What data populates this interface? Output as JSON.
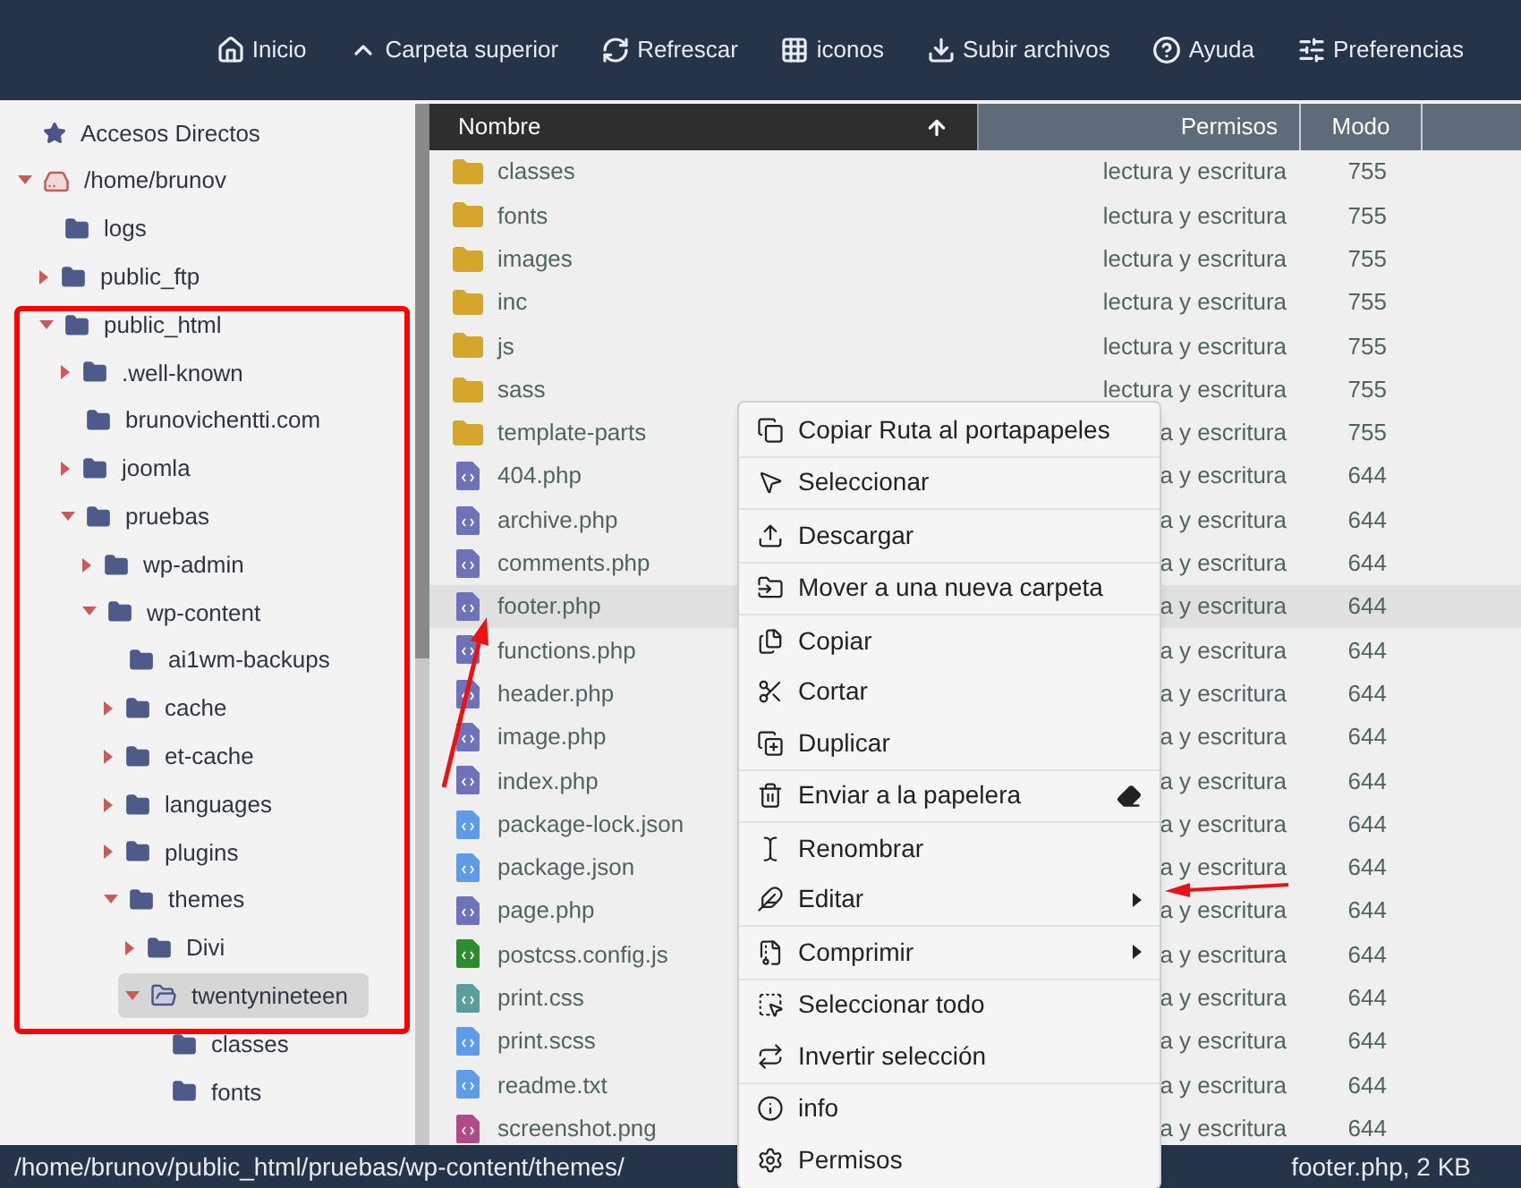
{
  "toolbar": [
    {
      "label": "Inicio"
    },
    {
      "label": "Carpeta superior"
    },
    {
      "label": "Refrescar"
    },
    {
      "label": "iconos"
    },
    {
      "label": "Subir archivos"
    },
    {
      "label": "Ayuda"
    },
    {
      "label": "Preferencias"
    }
  ],
  "tree": [
    {
      "label": "Accesos Directos",
      "kind": "shortcut",
      "selected": false
    },
    {
      "label": "/home/brunov",
      "kind": "drive",
      "expanded": true,
      "selected": false,
      "children": [
        {
          "label": "logs",
          "kind": "folder",
          "selected": false
        },
        {
          "label": "public_ftp",
          "kind": "folder",
          "expanded": false,
          "selected": false
        },
        {
          "label": "public_html",
          "kind": "folder",
          "expanded": true,
          "selected": false,
          "children": [
            {
              "label": ".well-known",
              "kind": "folder",
              "expanded": false,
              "selected": false
            },
            {
              "label": "brunovichentti.com",
              "kind": "folder",
              "selected": false
            },
            {
              "label": "joomla",
              "kind": "folder",
              "expanded": false,
              "selected": false
            },
            {
              "label": "pruebas",
              "kind": "folder",
              "expanded": true,
              "selected": false,
              "children": [
                {
                  "label": "wp-admin",
                  "kind": "folder",
                  "expanded": false,
                  "selected": false
                },
                {
                  "label": "wp-content",
                  "kind": "folder",
                  "expanded": true,
                  "selected": false,
                  "children": [
                    {
                      "label": "ai1wm-backups",
                      "kind": "folder",
                      "selected": false
                    },
                    {
                      "label": "cache",
                      "kind": "folder",
                      "expanded": false,
                      "selected": false
                    },
                    {
                      "label": "et-cache",
                      "kind": "folder",
                      "expanded": false,
                      "selected": false
                    },
                    {
                      "label": "languages",
                      "kind": "folder",
                      "expanded": false,
                      "selected": false
                    },
                    {
                      "label": "plugins",
                      "kind": "folder",
                      "expanded": false,
                      "selected": false
                    },
                    {
                      "label": "themes",
                      "kind": "folder",
                      "expanded": true,
                      "selected": false,
                      "children": [
                        {
                          "label": "Divi",
                          "kind": "folder",
                          "expanded": false,
                          "selected": false
                        },
                        {
                          "label": "twentynineteen",
                          "kind": "open-folder",
                          "expanded": true,
                          "selected": true,
                          "children": [
                            {
                              "label": "classes",
                              "kind": "folder",
                              "selected": false
                            },
                            {
                              "label": "fonts",
                              "kind": "folder",
                              "selected": false
                            }
                          ]
                        }
                      ]
                    }
                  ]
                }
              ]
            }
          ]
        }
      ]
    }
  ],
  "table": {
    "columns": [
      "Nombre",
      "Permisos",
      "Modo"
    ],
    "rows": [
      {
        "name": "classes",
        "kind": "folder",
        "permissions": "lectura y escritura",
        "mode": "755",
        "selected": false
      },
      {
        "name": "fonts",
        "kind": "folder",
        "permissions": "lectura y escritura",
        "mode": "755",
        "selected": false
      },
      {
        "name": "images",
        "kind": "folder",
        "permissions": "lectura y escritura",
        "mode": "755",
        "selected": false
      },
      {
        "name": "inc",
        "kind": "folder",
        "permissions": "lectura y escritura",
        "mode": "755",
        "selected": false
      },
      {
        "name": "js",
        "kind": "folder",
        "permissions": "lectura y escritura",
        "mode": "755",
        "selected": false
      },
      {
        "name": "sass",
        "kind": "folder",
        "permissions": "lectura y escritura",
        "mode": "755",
        "selected": false
      },
      {
        "name": "template-parts",
        "kind": "folder",
        "permissions": "a y escritura",
        "mode": "755",
        "selected": false
      },
      {
        "name": "404.php",
        "kind": "php",
        "permissions": "a y escritura",
        "mode": "644",
        "selected": false
      },
      {
        "name": "archive.php",
        "kind": "php",
        "permissions": "a y escritura",
        "mode": "644",
        "selected": false
      },
      {
        "name": "comments.php",
        "kind": "php",
        "permissions": "a y escritura",
        "mode": "644",
        "selected": false
      },
      {
        "name": "footer.php",
        "kind": "php",
        "permissions": "a y escritura",
        "mode": "644",
        "selected": true
      },
      {
        "name": "functions.php",
        "kind": "php",
        "permissions": "a y escritura",
        "mode": "644",
        "selected": false
      },
      {
        "name": "header.php",
        "kind": "php",
        "permissions": "a y escritura",
        "mode": "644",
        "selected": false
      },
      {
        "name": "image.php",
        "kind": "php",
        "permissions": "a y escritura",
        "mode": "644",
        "selected": false
      },
      {
        "name": "index.php",
        "kind": "php",
        "permissions": "a y escritura",
        "mode": "644",
        "selected": false
      },
      {
        "name": "package-lock.json",
        "kind": "text",
        "permissions": "a y escritura",
        "mode": "644",
        "selected": false
      },
      {
        "name": "package.json",
        "kind": "text",
        "permissions": "a y escritura",
        "mode": "644",
        "selected": false
      },
      {
        "name": "page.php",
        "kind": "php",
        "permissions": "a y escritura",
        "mode": "644",
        "selected": false
      },
      {
        "name": "postcss.config.js",
        "kind": "js",
        "permissions": "a y escritura",
        "mode": "644",
        "selected": false
      },
      {
        "name": "print.css",
        "kind": "css",
        "permissions": "a y escritura",
        "mode": "644",
        "selected": false
      },
      {
        "name": "print.scss",
        "kind": "text",
        "permissions": "a y escritura",
        "mode": "644",
        "selected": false
      },
      {
        "name": "readme.txt",
        "kind": "text",
        "permissions": "a y escritura",
        "mode": "644",
        "selected": false
      },
      {
        "name": "screenshot.png",
        "kind": "image",
        "permissions": "a y escritura",
        "mode": "644",
        "selected": false
      }
    ]
  },
  "context_menu": {
    "groups": [
      [
        {
          "label": "Copiar Ruta al portapapeles",
          "submenu": false
        }
      ],
      [
        {
          "label": "Seleccionar",
          "submenu": false
        }
      ],
      [
        {
          "label": "Descargar",
          "submenu": false
        }
      ],
      [
        {
          "label": "Mover a una nueva carpeta",
          "submenu": false
        }
      ],
      [
        {
          "label": "Copiar",
          "submenu": false
        },
        {
          "label": "Cortar",
          "submenu": false
        },
        {
          "label": "Duplicar",
          "submenu": false
        }
      ],
      [
        {
          "label": "Enviar a la papelera",
          "submenu": false
        }
      ],
      [
        {
          "label": "Renombrar",
          "submenu": false
        },
        {
          "label": "Editar",
          "submenu": true
        }
      ],
      [
        {
          "label": "Comprimir",
          "submenu": true
        }
      ],
      [
        {
          "label": "Seleccionar todo",
          "submenu": false
        },
        {
          "label": "Invertir selección",
          "submenu": false
        }
      ],
      [
        {
          "label": "info",
          "submenu": false
        },
        {
          "label": "Permisos",
          "submenu": false
        }
      ]
    ]
  },
  "status_bar": {
    "path": "/home/brunov/public_html/pruebas/wp-content/themes/",
    "selection": "footer.php, 2 KB"
  }
}
